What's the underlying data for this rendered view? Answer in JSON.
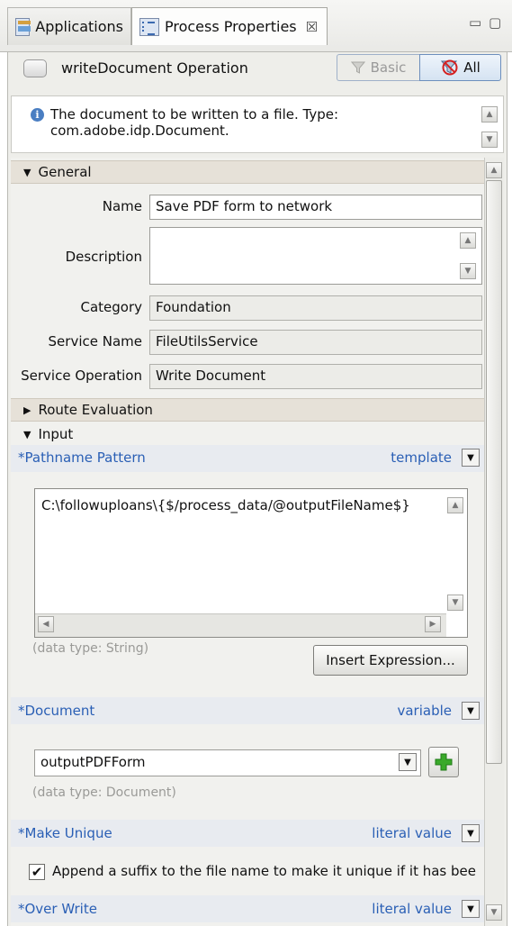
{
  "tabs": {
    "applications": "Applications",
    "process_properties": "Process Properties",
    "close_glyph": "☒"
  },
  "window_controls": {
    "minimize": "▭",
    "maximize": "▢"
  },
  "header": {
    "title": "writeDocument Operation",
    "basic_label": "Basic",
    "all_label": "All"
  },
  "description_box": {
    "line1": "The document to be written to a file. Type:",
    "line2": "com.adobe.idp.Document."
  },
  "general": {
    "section_label": "General",
    "name_label": "Name",
    "name_value": "Save PDF form to network",
    "description_label": "Description",
    "description_value": "",
    "category_label": "Category",
    "category_value": "Foundation",
    "service_name_label": "Service Name",
    "service_name_value": "FileUtilsService",
    "service_operation_label": "Service Operation",
    "service_operation_value": "Write Document"
  },
  "route_evaluation": {
    "section_label": "Route Evaluation"
  },
  "input": {
    "section_label": "Input",
    "pathname": {
      "label": "*Pathname Pattern",
      "mode": "template",
      "value": "C:\\followuploans\\{$/process_data/@outputFileName$}",
      "data_type": "(data type: String)",
      "insert_button": "Insert Expression..."
    },
    "document": {
      "label": "*Document",
      "mode": "variable",
      "value": "outputPDFForm",
      "data_type": "(data type: Document)"
    },
    "make_unique": {
      "label": "*Make Unique",
      "mode": "literal value",
      "checkbox_label": "Append a suffix to the file name to make it unique if it has bee",
      "checked": true
    },
    "over_write": {
      "label": "*Over Write",
      "mode": "literal value"
    }
  },
  "colors": {
    "accent_blue": "#2a5fb5",
    "section_band": "#e6e1d8",
    "add_green": "#3aa92a"
  }
}
